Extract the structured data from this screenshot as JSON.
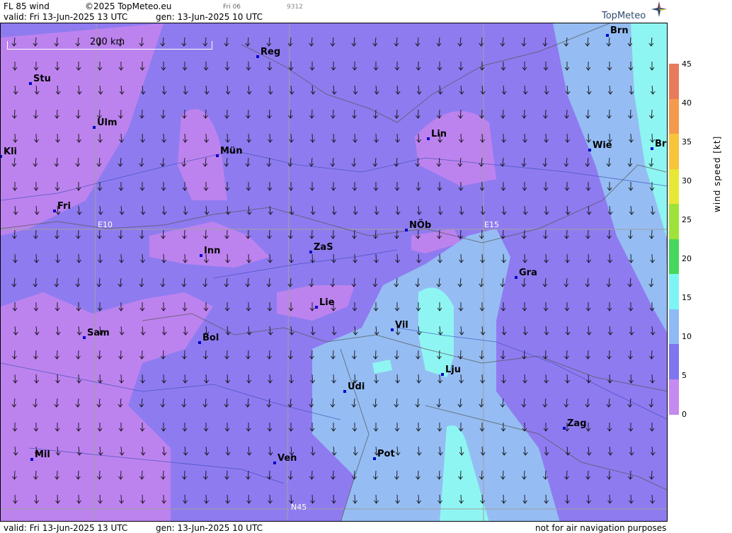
{
  "header": {
    "title": "FL 85 wind",
    "copyright": "©2025 TopMeteo.eu",
    "day_code": "Fri 06",
    "run_code": "9312",
    "valid": "valid:  Fri  13-Jun-2025  13 UTC",
    "gen": "gen: 13-Jun-2025 10 UTC",
    "logo": "TopMeteo"
  },
  "footer": {
    "valid": "valid:  Fri  13-Jun-2025  13 UTC",
    "gen": "gen: 13-Jun-2025 10 UTC",
    "disclaimer": "not for air navigation purposes"
  },
  "scale": {
    "label": "200 km"
  },
  "grid_labels": {
    "lon1": "E10",
    "lon2": "E15",
    "lat1": "N45"
  },
  "cities": [
    {
      "name": "Brn"
    },
    {
      "name": "Reg"
    },
    {
      "name": "Stu"
    },
    {
      "name": "Ulm"
    },
    {
      "name": "Kli"
    },
    {
      "name": "Mün"
    },
    {
      "name": "Lin"
    },
    {
      "name": "Wie"
    },
    {
      "name": "Br"
    },
    {
      "name": "Fri"
    },
    {
      "name": "NÖb"
    },
    {
      "name": "Inn"
    },
    {
      "name": "ZaS"
    },
    {
      "name": "Gra"
    },
    {
      "name": "Lie"
    },
    {
      "name": "Vil"
    },
    {
      "name": "Sam"
    },
    {
      "name": "Bol"
    },
    {
      "name": "Lju"
    },
    {
      "name": "Udi"
    },
    {
      "name": "Zag"
    },
    {
      "name": "Mil"
    },
    {
      "name": "Ven"
    },
    {
      "name": "Pot"
    }
  ],
  "legend": {
    "title": "wind speed  [kt]",
    "ticks": [
      "45",
      "40",
      "35",
      "30",
      "25",
      "20",
      "15",
      "10",
      "5",
      "0"
    ],
    "colors": [
      "#e77b5c",
      "#f39a4c",
      "#f8c43c",
      "#e6e835",
      "#9ee23a",
      "#45d85c",
      "#7df5f5",
      "#8ebaf5",
      "#7d76ee",
      "#c58aef"
    ]
  },
  "colors": {
    "band_0_5": "#bc83ee",
    "band_5_10": "#8f7bf0",
    "band_10_15": "#95bdf3",
    "band_15_20": "#8ff5f2"
  }
}
